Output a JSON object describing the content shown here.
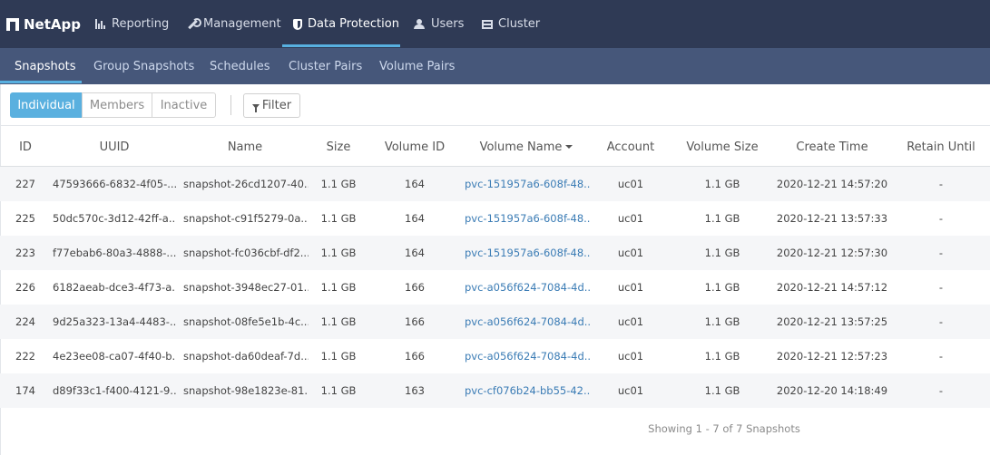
{
  "brand": {
    "name": "NetApp"
  },
  "top_nav": [
    {
      "label": "Reporting",
      "icon": "bar-chart-icon"
    },
    {
      "label": "Management",
      "icon": "wrench-icon"
    },
    {
      "label": "Data Protection",
      "icon": "shield-icon",
      "active": true
    },
    {
      "label": "Users",
      "icon": "users-icon"
    },
    {
      "label": "Cluster",
      "icon": "server-icon"
    }
  ],
  "sub_nav": [
    {
      "label": "Snapshots",
      "active": true
    },
    {
      "label": "Group Snapshots"
    },
    {
      "label": "Schedules"
    },
    {
      "label": "Cluster Pairs"
    },
    {
      "label": "Volume Pairs"
    }
  ],
  "toolbar": {
    "views": [
      {
        "label": "Individual",
        "active": true
      },
      {
        "label": "Members"
      },
      {
        "label": "Inactive"
      }
    ],
    "filter_label": "Filter"
  },
  "table": {
    "columns": [
      "ID",
      "UUID",
      "Name",
      "Size",
      "Volume ID",
      "Volume Name",
      "Account",
      "Volume Size",
      "Create Time",
      "Retain Until"
    ],
    "sorted_column": "Volume Name",
    "rows": [
      [
        "227",
        "47593666-6832-4f05-...",
        "snapshot-26cd1207-40...",
        "1.1 GB",
        "164",
        "pvc-151957a6-608f-48...",
        "uc01",
        "1.1 GB",
        "2020-12-21 14:57:20",
        "-"
      ],
      [
        "225",
        "50dc570c-3d12-42ff-a...",
        "snapshot-c91f5279-0a...",
        "1.1 GB",
        "164",
        "pvc-151957a6-608f-48...",
        "uc01",
        "1.1 GB",
        "2020-12-21 13:57:33",
        "-"
      ],
      [
        "223",
        "f77ebab6-80a3-4888-...",
        "snapshot-fc036cbf-df2...",
        "1.1 GB",
        "164",
        "pvc-151957a6-608f-48...",
        "uc01",
        "1.1 GB",
        "2020-12-21 12:57:30",
        "-"
      ],
      [
        "226",
        "6182aeab-dce3-4f73-a...",
        "snapshot-3948ec27-01...",
        "1.1 GB",
        "166",
        "pvc-a056f624-7084-4d...",
        "uc01",
        "1.1 GB",
        "2020-12-21 14:57:12",
        "-"
      ],
      [
        "224",
        "9d25a323-13a4-4483-...",
        "snapshot-08fe5e1b-4c...",
        "1.1 GB",
        "166",
        "pvc-a056f624-7084-4d...",
        "uc01",
        "1.1 GB",
        "2020-12-21 13:57:25",
        "-"
      ],
      [
        "222",
        "4e23ee08-ca07-4f40-b...",
        "snapshot-da60deaf-7d...",
        "1.1 GB",
        "166",
        "pvc-a056f624-7084-4d...",
        "uc01",
        "1.1 GB",
        "2020-12-21 12:57:23",
        "-"
      ],
      [
        "174",
        "d89f33c1-f400-4121-9...",
        "snapshot-98e1823e-81...",
        "1.1 GB",
        "163",
        "pvc-cf076b24-bb55-42...",
        "uc01",
        "1.1 GB",
        "2020-12-20 14:18:49",
        "-"
      ]
    ]
  },
  "footer": {
    "status": "Showing 1 - 7 of 7 Snapshots"
  },
  "colors": {
    "topbar": "#2f3a55",
    "subbar": "#46577a",
    "accent": "#58b0e0",
    "link": "#3b7cb5"
  }
}
